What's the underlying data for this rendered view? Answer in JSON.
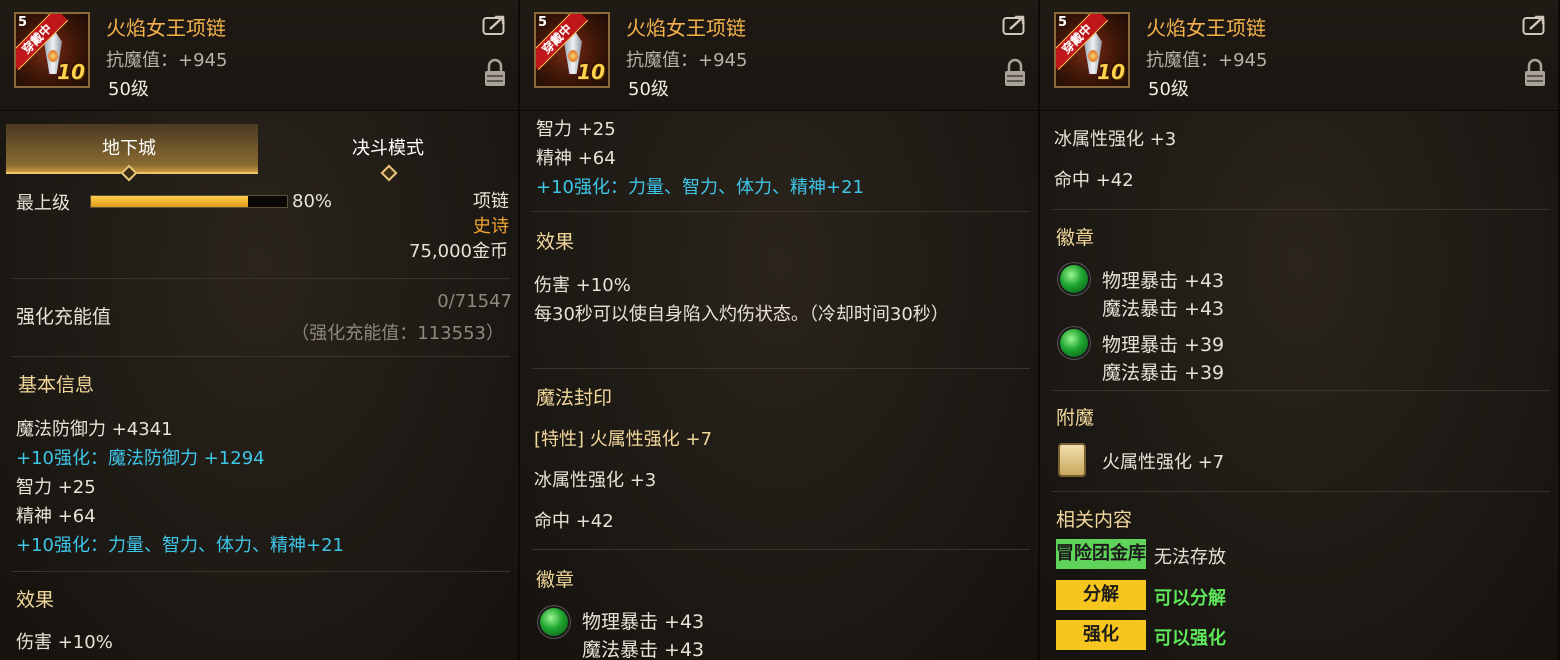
{
  "panels": [
    {
      "header": {
        "level_corner": "5",
        "equipped_label": "穿戴中",
        "enhance_level": "10",
        "name": "火焰女王项链",
        "stat": "抗魔值：+945",
        "level": "50级"
      },
      "tabs": {
        "dungeon": "地下城",
        "duel": "决斗模式"
      },
      "rarity": {
        "label": "最上级",
        "percent": "80%",
        "progress": 0.8,
        "item_type": "项链",
        "grade": "史诗",
        "price": "75,000金币"
      },
      "charge": {
        "label": "强化充能值",
        "value": "0/71547",
        "sub": "（强化充能值：113553）"
      },
      "basic": {
        "title": "基本信息",
        "lines": [
          "魔法防御力 +4341",
          "+10强化：魔法防御力 +1294",
          "智力 +25",
          "精神 +64",
          "+10强化：力量、智力、体力、精神+21"
        ]
      },
      "effect": {
        "title": "效果",
        "line1": "伤害 +10%"
      }
    },
    {
      "header": {
        "level_corner": "5",
        "equipped_label": "穿戴中",
        "enhance_level": "10",
        "name": "火焰女王项链",
        "stat": "抗魔值：+945",
        "level": "50级"
      },
      "top_lines": [
        "智力 +25",
        "精神 +64",
        "+10强化：力量、智力、体力、精神+21"
      ],
      "effect": {
        "title": "效果",
        "line1": "伤害 +10%",
        "line2": "每30秒可以使自身陷入灼伤状态。（冷却时间30秒）"
      },
      "seal": {
        "title": "魔法封印",
        "line1": "[特性] 火属性强化 +7",
        "line2": "冰属性强化 +3",
        "line3": "命中 +42"
      },
      "emblem": {
        "title": "徽章",
        "line1": "物理暴击 +43",
        "line2": "魔法暴击 +43"
      }
    },
    {
      "header": {
        "level_corner": "5",
        "equipped_label": "穿戴中",
        "enhance_level": "10",
        "name": "火焰女王项链",
        "stat": "抗魔值：+945",
        "level": "50级"
      },
      "top_lines": [
        "冰属性强化 +3",
        "命中 +42"
      ],
      "emblem": {
        "title": "徽章",
        "slot1": [
          "物理暴击 +43",
          "魔法暴击 +43"
        ],
        "slot2": [
          "物理暴击 +39",
          "魔法暴击 +39"
        ]
      },
      "enchant": {
        "title": "附魔",
        "line": "火属性强化 +7"
      },
      "related": {
        "title": "相关内容",
        "items": [
          {
            "badge": "冒险团金库",
            "status": "无法存放"
          },
          {
            "badge": "分解",
            "status": "可以分解"
          },
          {
            "badge": "强化",
            "status": "可以强化"
          }
        ]
      }
    }
  ]
}
